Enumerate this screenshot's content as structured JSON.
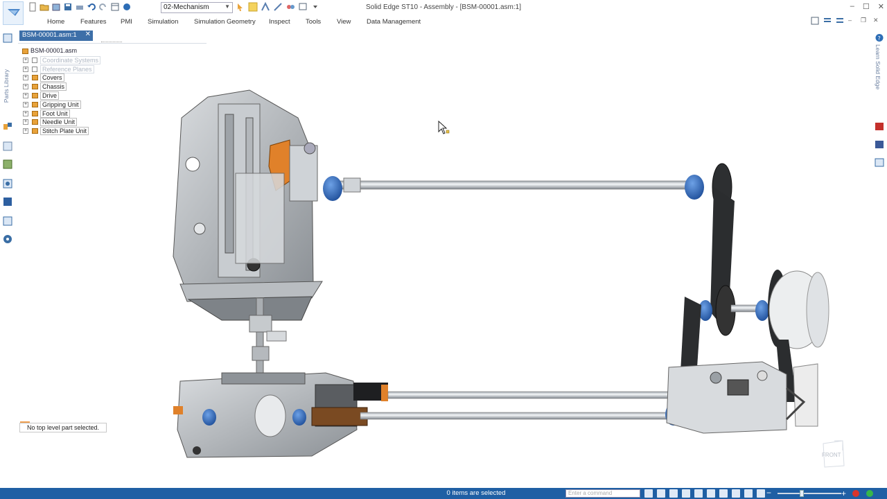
{
  "window": {
    "title": "Solid Edge ST10 - Assembly - [BSM-00001.asm:1]",
    "doc_select_value": "02-Mechanism"
  },
  "ribbon": {
    "tabs": [
      "Home",
      "Features",
      "PMI",
      "Simulation",
      "Simulation Geometry",
      "Inspect",
      "Tools",
      "View",
      "Data Management"
    ]
  },
  "left_bar": {
    "vertical_label": "Parts Library"
  },
  "right_bar": {
    "vertical_label": "Learn Solid Edge"
  },
  "document_tab": {
    "label": "BSM-00001.asm:1"
  },
  "tree": {
    "root": "BSM-00001.asm",
    "items": [
      {
        "label": "Coordinate Systems",
        "dim": true
      },
      {
        "label": "Reference Planes",
        "dim": true
      },
      {
        "label": "Covers",
        "dim": false
      },
      {
        "label": "Chassis",
        "dim": false
      },
      {
        "label": "Drive",
        "dim": false
      },
      {
        "label": "Gripping Unit",
        "dim": false
      },
      {
        "label": "Foot Unit",
        "dim": false
      },
      {
        "label": "Needle Unit",
        "dim": false
      },
      {
        "label": "Stitch Plate Unit",
        "dim": false
      }
    ]
  },
  "status_message": "No top level part selected.",
  "view": {
    "orientation_label": "FRONT"
  },
  "statusbar": {
    "selection_text": "0 items are selected",
    "command_placeholder": "Enter a command"
  },
  "colors": {
    "accent": "#1f5fa4",
    "doc_tab": "#3d6fa8",
    "folder": "#e8a23a",
    "part_blue": "#2f6fc8",
    "part_orange": "#e0812a"
  },
  "icons": [
    "app-logo-icon",
    "new-icon",
    "open-icon",
    "save-icon",
    "undo-icon",
    "redo-icon",
    "fit-icon",
    "help-icon",
    "minimize-icon",
    "maximize-icon",
    "close-icon"
  ]
}
